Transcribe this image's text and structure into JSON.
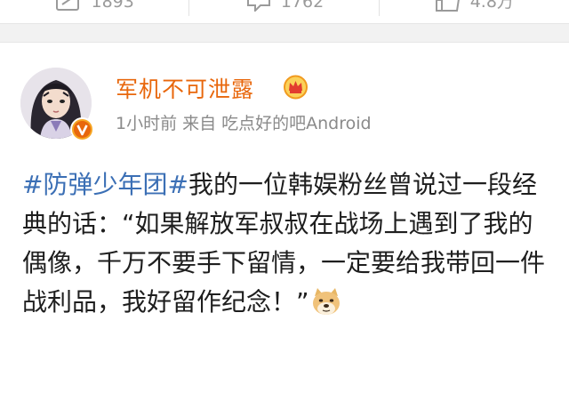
{
  "actions": [
    {
      "name": "repost",
      "count": "1893"
    },
    {
      "name": "comment",
      "count": "1762"
    },
    {
      "name": "like",
      "count": "4.8万"
    }
  ],
  "post": {
    "username": "军机不可泄露",
    "time": "1小时前",
    "source_prefix": "来自",
    "source": "吃点好的吧Android",
    "topic": "#防弹少年团#",
    "body": "我的一位韩娱粉丝曾说过一段经典的话：“如果解放军叔叔在战场上遇到了我的偶像，千万不要手下留情，一定要给我带回一件战利品，我好留作纪念！”",
    "emoji": "doge-emoji"
  },
  "colors": {
    "username": "#e8670c",
    "topic": "#3b6fb5",
    "meta": "#8a8a8a",
    "band": "#f2f2f2"
  }
}
